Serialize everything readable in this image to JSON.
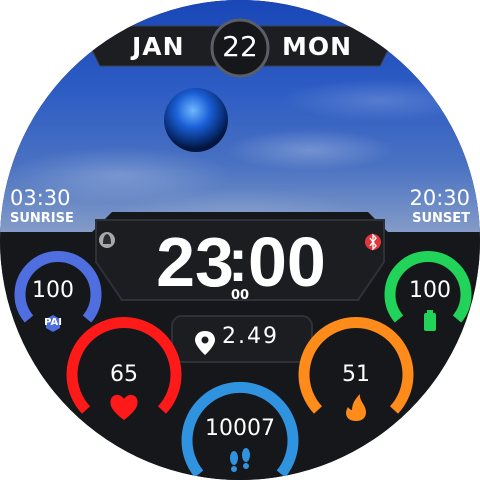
{
  "date": {
    "month": "JAN",
    "day": "22",
    "weekday": "MON"
  },
  "sun": {
    "sunrise_time": "03:30",
    "sunrise_label": "SUNRISE",
    "sunset_time": "20:30",
    "sunset_label": "SUNSET"
  },
  "time": {
    "hours": "23",
    "minutes": "00",
    "seconds": "00"
  },
  "distance": {
    "value": "2.49"
  },
  "gauges": {
    "pai": {
      "value": "100",
      "badge": "PAI",
      "level": 1.0,
      "color": "#4f6fe0"
    },
    "battery": {
      "value": "100",
      "level": 1.0,
      "color": "#22d35a"
    },
    "heart": {
      "value": "65",
      "level": 1.0,
      "color": "#ff1a1a"
    },
    "calories": {
      "value": "51",
      "level": 1.0,
      "color": "#ff8c1a"
    },
    "steps": {
      "value": "10007",
      "level": 1.0,
      "color": "#2f93e0"
    }
  },
  "colors": {
    "bg": "#0d0f12",
    "panel": "#1b1d21",
    "accent_bt": "#e0383a",
    "alarm": "#b0b0b0"
  },
  "icons": [
    "alarm-bell-icon",
    "bluetooth-icon",
    "location-pin-icon",
    "heart-icon",
    "flame-icon",
    "footsteps-icon",
    "battery-icon"
  ]
}
